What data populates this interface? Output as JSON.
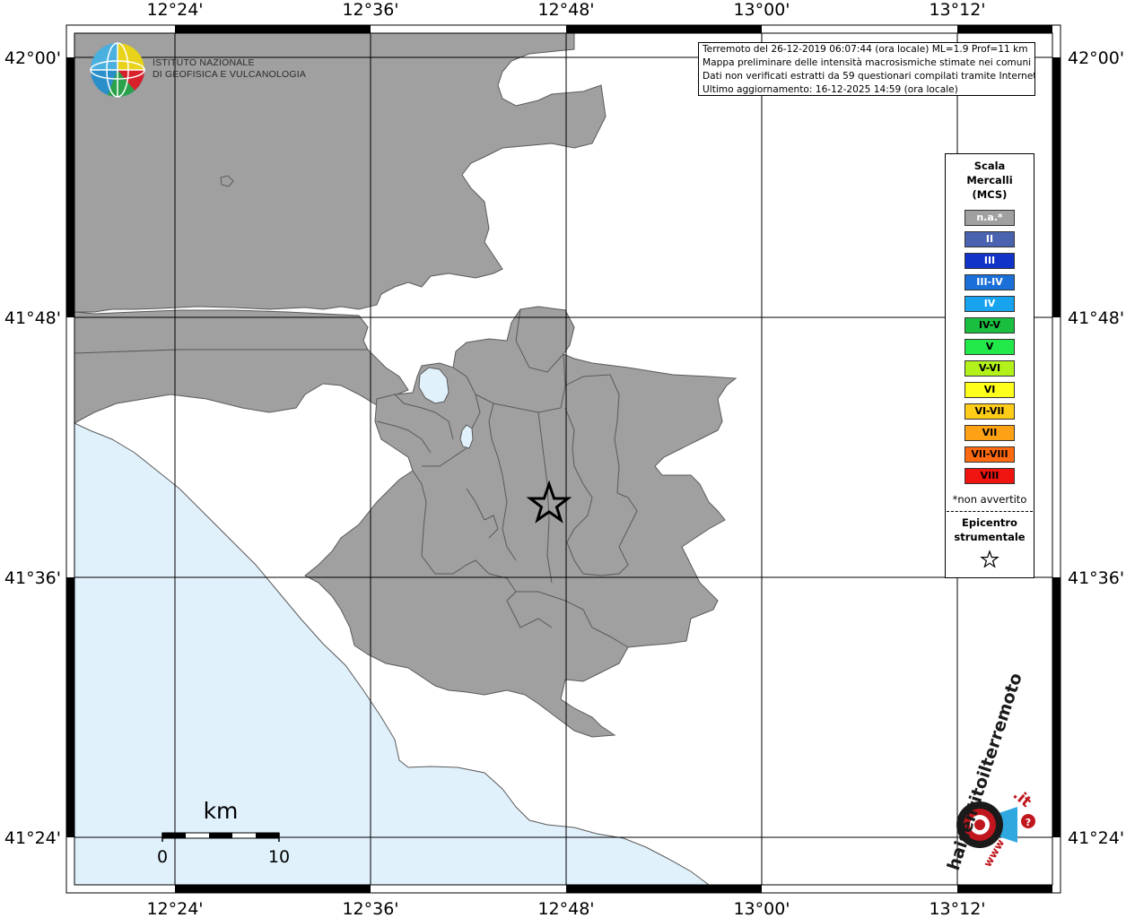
{
  "map": {
    "lon_labels": [
      "12°24'",
      "12°36'",
      "12°48'",
      "13°00'",
      "13°12'"
    ],
    "lat_labels": [
      "42°00'",
      "41°48'",
      "41°36'",
      "41°24'"
    ],
    "colors": {
      "land": "#a0a0a0",
      "sea": "#e0f1fc",
      "background": "#ffffff",
      "border": "#5a5a5a"
    }
  },
  "info": {
    "line1": "Terremoto del 26-12-2019 06:07:44 (ora locale) ML=1.9 Prof=11 km",
    "line2": "Mappa preliminare delle intensità macrosismiche stimate nei comuni",
    "line3": "Dati non verificati estratti da 59 questionari compilati tramite Internet.",
    "line4": "Ultimo aggiornamento: 16-12-2025 14:59 (ora locale)"
  },
  "logo": {
    "line1": "ISTITUTO NAZIONALE",
    "line2": "DI GEOFISICA E VULCANOLOGIA",
    "icon": "ingv-globe-icon"
  },
  "legend": {
    "title": [
      "Scala",
      "Mercalli",
      "(MCS)"
    ],
    "items": [
      {
        "label": "n.a.*",
        "color": "#a0a0a0"
      },
      {
        "label": "II",
        "color": "#4a63b0"
      },
      {
        "label": "III",
        "color": "#1133c7"
      },
      {
        "label": "III-IV",
        "color": "#1a6fd8"
      },
      {
        "label": "IV",
        "color": "#18a3ef"
      },
      {
        "label": "IV-V",
        "color": "#1bbf3f"
      },
      {
        "label": "V",
        "color": "#22e84a"
      },
      {
        "label": "V-VI",
        "color": "#b2f21a"
      },
      {
        "label": "VI",
        "color": "#ffff1c"
      },
      {
        "label": "VI-VII",
        "color": "#ffcc18"
      },
      {
        "label": "VII",
        "color": "#ffa114"
      },
      {
        "label": "VII-VIII",
        "color": "#ff6a10"
      },
      {
        "label": "VIII",
        "color": "#f01410"
      }
    ],
    "note": "*non avvertito",
    "epicentre": [
      "Epicentro",
      "strumentale"
    ],
    "epicentre_icon": "star-outline-icon"
  },
  "scalebar": {
    "unit": "km",
    "min": "0",
    "max": "10"
  },
  "badge": {
    "text_main": "haisentitoilterremoto",
    "text_it": ".it",
    "text_www": "www",
    "icon": "target-speaker-icon"
  }
}
